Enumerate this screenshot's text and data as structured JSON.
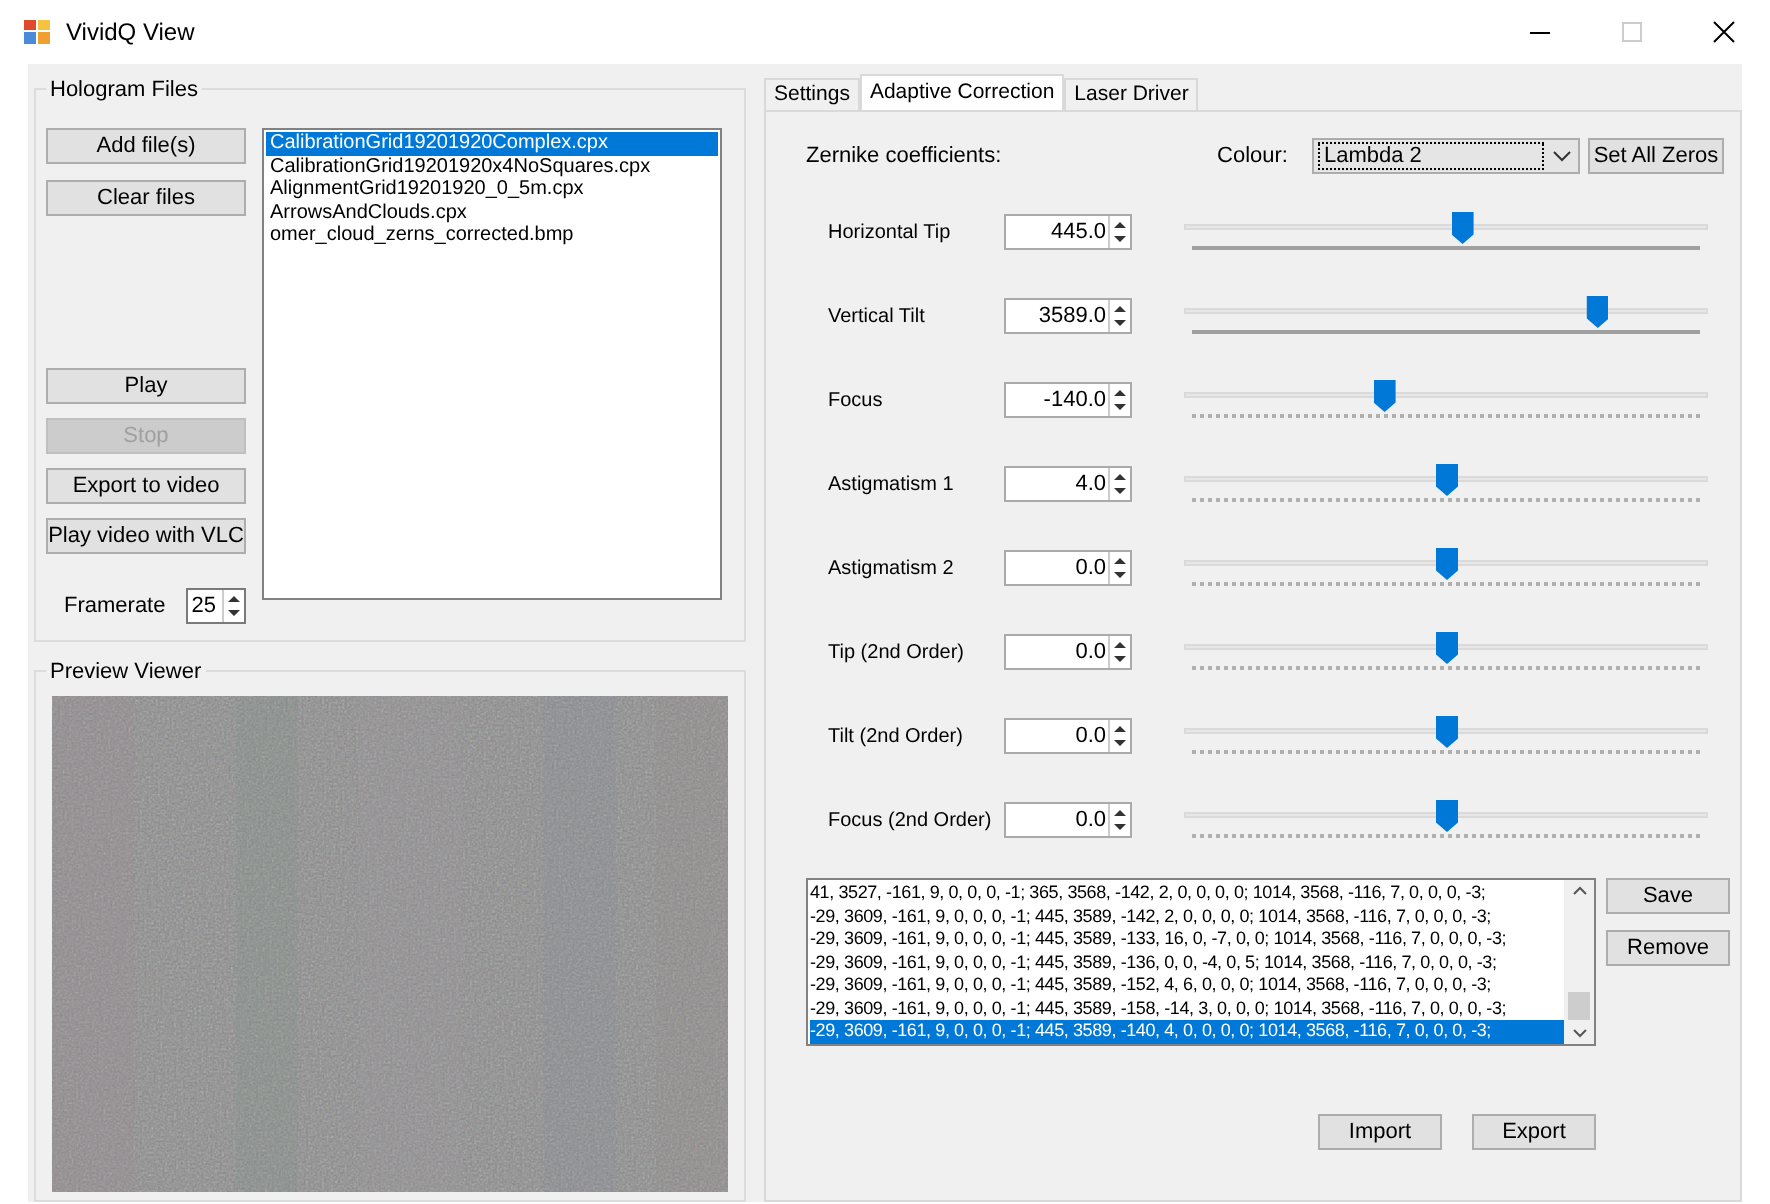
{
  "window": {
    "title": "VividQ View"
  },
  "hologram_files": {
    "title": "Hologram Files",
    "buttons": [
      {
        "label": "Add file(s)",
        "disabled": false
      },
      {
        "label": "Clear files",
        "disabled": false
      }
    ],
    "playback_buttons": [
      {
        "label": "Play",
        "disabled": false
      },
      {
        "label": "Stop",
        "disabled": true
      },
      {
        "label": "Export to video",
        "disabled": false
      },
      {
        "label": "Play video with VLC",
        "disabled": false
      }
    ],
    "framerate": {
      "label": "Framerate",
      "value": "25"
    },
    "files": [
      {
        "name": "CalibrationGrid19201920Complex.cpx",
        "selected": true
      },
      {
        "name": "CalibrationGrid19201920x4NoSquares.cpx",
        "selected": false
      },
      {
        "name": "AlignmentGrid19201920_0_5m.cpx",
        "selected": false
      },
      {
        "name": "ArrowsAndClouds.cpx",
        "selected": false
      },
      {
        "name": "omer_cloud_zerns_corrected.bmp",
        "selected": false
      }
    ]
  },
  "preview": {
    "title": "Preview Viewer",
    "kind": "picture"
  },
  "tabs": [
    {
      "label": "Settings",
      "selected": false
    },
    {
      "label": "Adaptive Correction",
      "selected": true
    },
    {
      "label": "Laser Driver",
      "selected": false
    }
  ],
  "zernike": {
    "title": "Zernike coefficients:",
    "colour_label": "Colour:",
    "colour_value": "Lambda 2",
    "set_zeros": "Set All Zeros",
    "coefficients": [
      {
        "name": "Horizontal Tip",
        "value": "445.0",
        "level": 0.53,
        "kind": "solid"
      },
      {
        "name": "Vertical Tilt",
        "value": "3589.0",
        "level": 0.79,
        "kind": "solid"
      },
      {
        "name": "Focus",
        "value": "-140.0",
        "level": 0.38,
        "kind": "dotted"
      },
      {
        "name": "Astigmatism 1",
        "value": "4.0",
        "level": 0.5,
        "kind": "dotted"
      },
      {
        "name": "Astigmatism 2",
        "value": "0.0",
        "level": 0.5,
        "kind": "dotted"
      },
      {
        "name": "Tip (2nd Order)",
        "value": "0.0",
        "level": 0.5,
        "kind": "dotted"
      },
      {
        "name": "Tilt (2nd Order)",
        "value": "0.0",
        "level": 0.5,
        "kind": "dotted"
      },
      {
        "name": "Focus (2nd Order)",
        "value": "0.0",
        "level": 0.5,
        "kind": "dotted"
      }
    ]
  },
  "presets": {
    "rows": [
      {
        "text": "41, 3527, -161, 9, 0, 0, 0, -1; 365, 3568, -142, 2, 0, 0, 0, 0; 1014, 3568, -116, 7, 0, 0, 0, -3;",
        "selected": false
      },
      {
        "text": "-29, 3609, -161, 9, 0, 0, 0, -1; 445, 3589, -142, 2, 0, 0, 0, 0; 1014, 3568, -116, 7, 0, 0, 0, -3;",
        "selected": false
      },
      {
        "text": "-29, 3609, -161, 9, 0, 0, 0, -1; 445, 3589, -133, 16, 0, -7, 0, 0; 1014, 3568, -116, 7, 0, 0, 0, -3;",
        "selected": false
      },
      {
        "text": "-29, 3609, -161, 9, 0, 0, 0, -1; 445, 3589, -136, 0, 0, -4, 0, 5; 1014, 3568, -116, 7, 0, 0, 0, -3;",
        "selected": false
      },
      {
        "text": "-29, 3609, -161, 9, 0, 0, 0, -1; 445, 3589, -152, 4, 6, 0, 0, 0; 1014, 3568, -116, 7, 0, 0, 0, -3;",
        "selected": false
      },
      {
        "text": "-29, 3609, -161, 9, 0, 0, 0, -1; 445, 3589, -158, -14, 3, 0, 0, 0; 1014, 3568, -116, 7, 0, 0, 0, -3;",
        "selected": false
      },
      {
        "text": "-29, 3609, -161, 9, 0, 0, 0, -1; 445, 3589, -140, 4, 0, 0, 0, 0; 1014, 3568, -116, 7, 0, 0, 0, -3;",
        "selected": true
      }
    ],
    "side_buttons": [
      "Save",
      "Remove"
    ],
    "bottom_buttons": [
      "Import",
      "Export"
    ]
  }
}
